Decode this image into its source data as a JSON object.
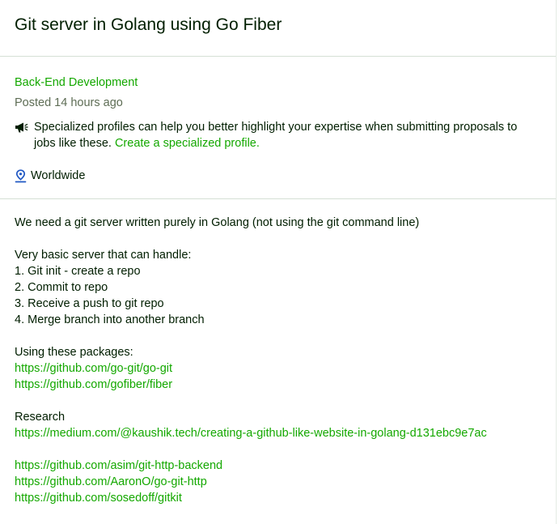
{
  "job": {
    "title": "Git server in Golang using Go Fiber",
    "category": "Back-End Development",
    "posted": "Posted 14 hours ago",
    "notice_text": "Specialized profiles can help you better highlight your expertise when submitting proposals to jobs like these.",
    "notice_link": "Create a specialized profile.",
    "location": "Worldwide",
    "location_icon": "map-pin-icon",
    "notice_icon": "megaphone-icon",
    "accent_color": "#14a800"
  },
  "description": {
    "intro": "We need a git server written purely in Golang (not using the git command line)",
    "basic_heading": "Very basic server that can handle:",
    "requirements": [
      "1. Git init - create a repo",
      "2. Commit to repo",
      "3. Receive a push to git repo",
      "4. Merge branch into another branch"
    ],
    "packages_heading": "Using these packages:",
    "packages": [
      "https://github.com/go-git/go-git",
      "https://github.com/gofiber/fiber"
    ],
    "research_heading": "Research",
    "research_links": [
      "https://medium.com/@kaushik.tech/creating-a-github-like-website-in-golang-d131ebc9e7ac"
    ],
    "more_links": [
      "https://github.com/asim/git-http-backend",
      "https://github.com/AaronO/go-git-http",
      "https://github.com/sosedoff/gitkit"
    ]
  }
}
